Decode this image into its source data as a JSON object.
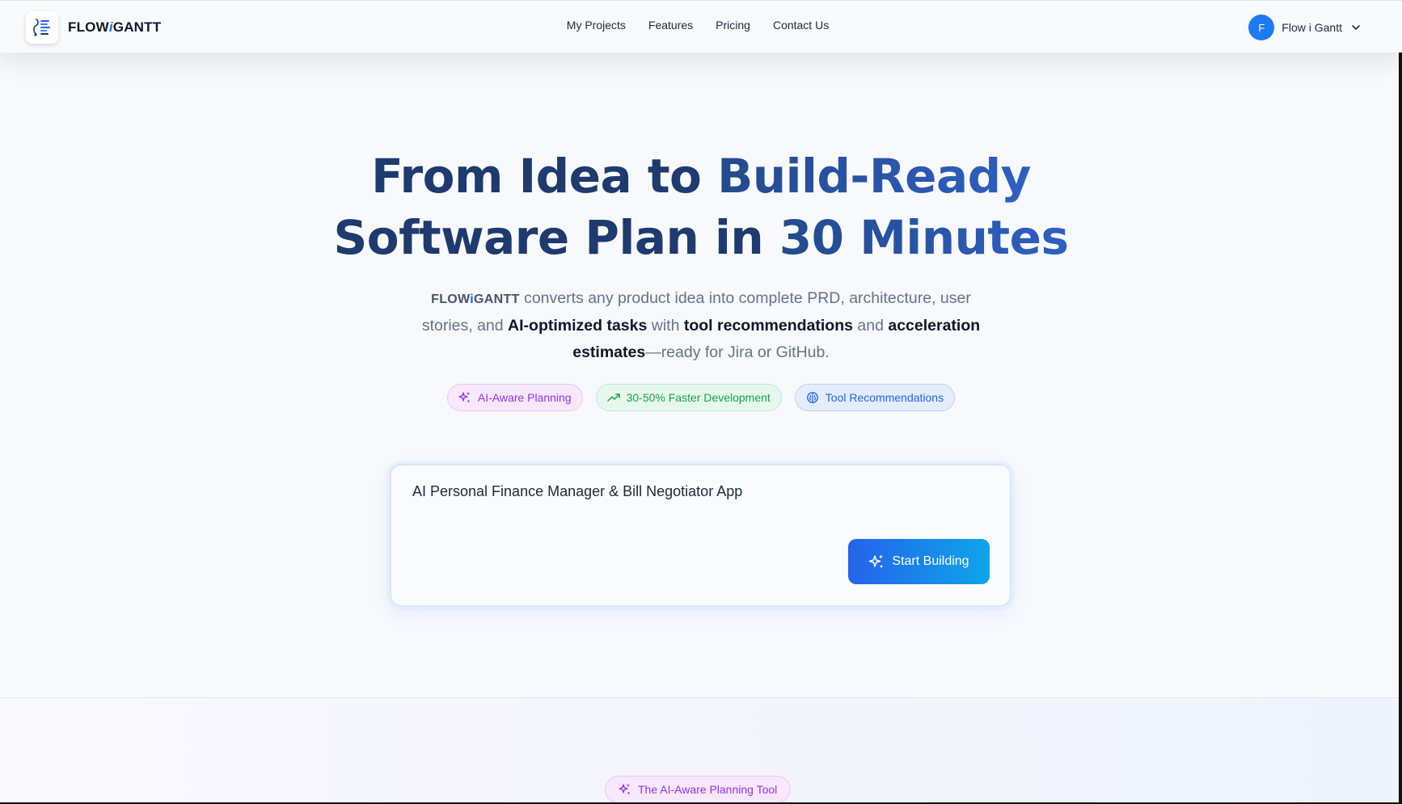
{
  "header": {
    "brand": {
      "prefix": "FLOW",
      "mid": "i",
      "suffix": "GANTT"
    },
    "nav": [
      {
        "label": "My Projects"
      },
      {
        "label": "Features"
      },
      {
        "label": "Pricing"
      },
      {
        "label": "Contact Us"
      }
    ],
    "user": {
      "initial": "F",
      "name": "Flow i Gantt"
    }
  },
  "hero": {
    "title_part1": "From Idea to ",
    "title_grad1": "Build-Ready",
    "title_part2": "Software Plan in ",
    "title_grad2": "30 Minutes",
    "desc": {
      "text1": " converts any product idea into complete PRD, architecture, user stories, and ",
      "bold1": "AI-optimized tasks",
      "text2": " with ",
      "bold2": "tool recommendations",
      "text3": " and ",
      "bold3": "acceleration estimates",
      "text4": "—ready for Jira or GitHub."
    },
    "badges": [
      {
        "label": "AI-Aware Planning",
        "icon": "sparkles-icon",
        "color": "#9333ea"
      },
      {
        "label": "30-50% Faster Development",
        "icon": "trending-up-icon",
        "color": "#16a34a"
      },
      {
        "label": "Tool Recommendations",
        "icon": "brain-icon",
        "color": "#2563eb"
      }
    ]
  },
  "idea_input": {
    "value": "AI Personal Finance Manager & Bill Negotiator App",
    "button_label": "Start Building"
  },
  "section2": {
    "badge_label": "The AI-Aware Planning Tool"
  },
  "colors": {
    "primary": "#2563eb",
    "accent": "#0ea5e9",
    "title": "#1e3a6e",
    "purple": "#9333ea",
    "green": "#16a34a"
  }
}
